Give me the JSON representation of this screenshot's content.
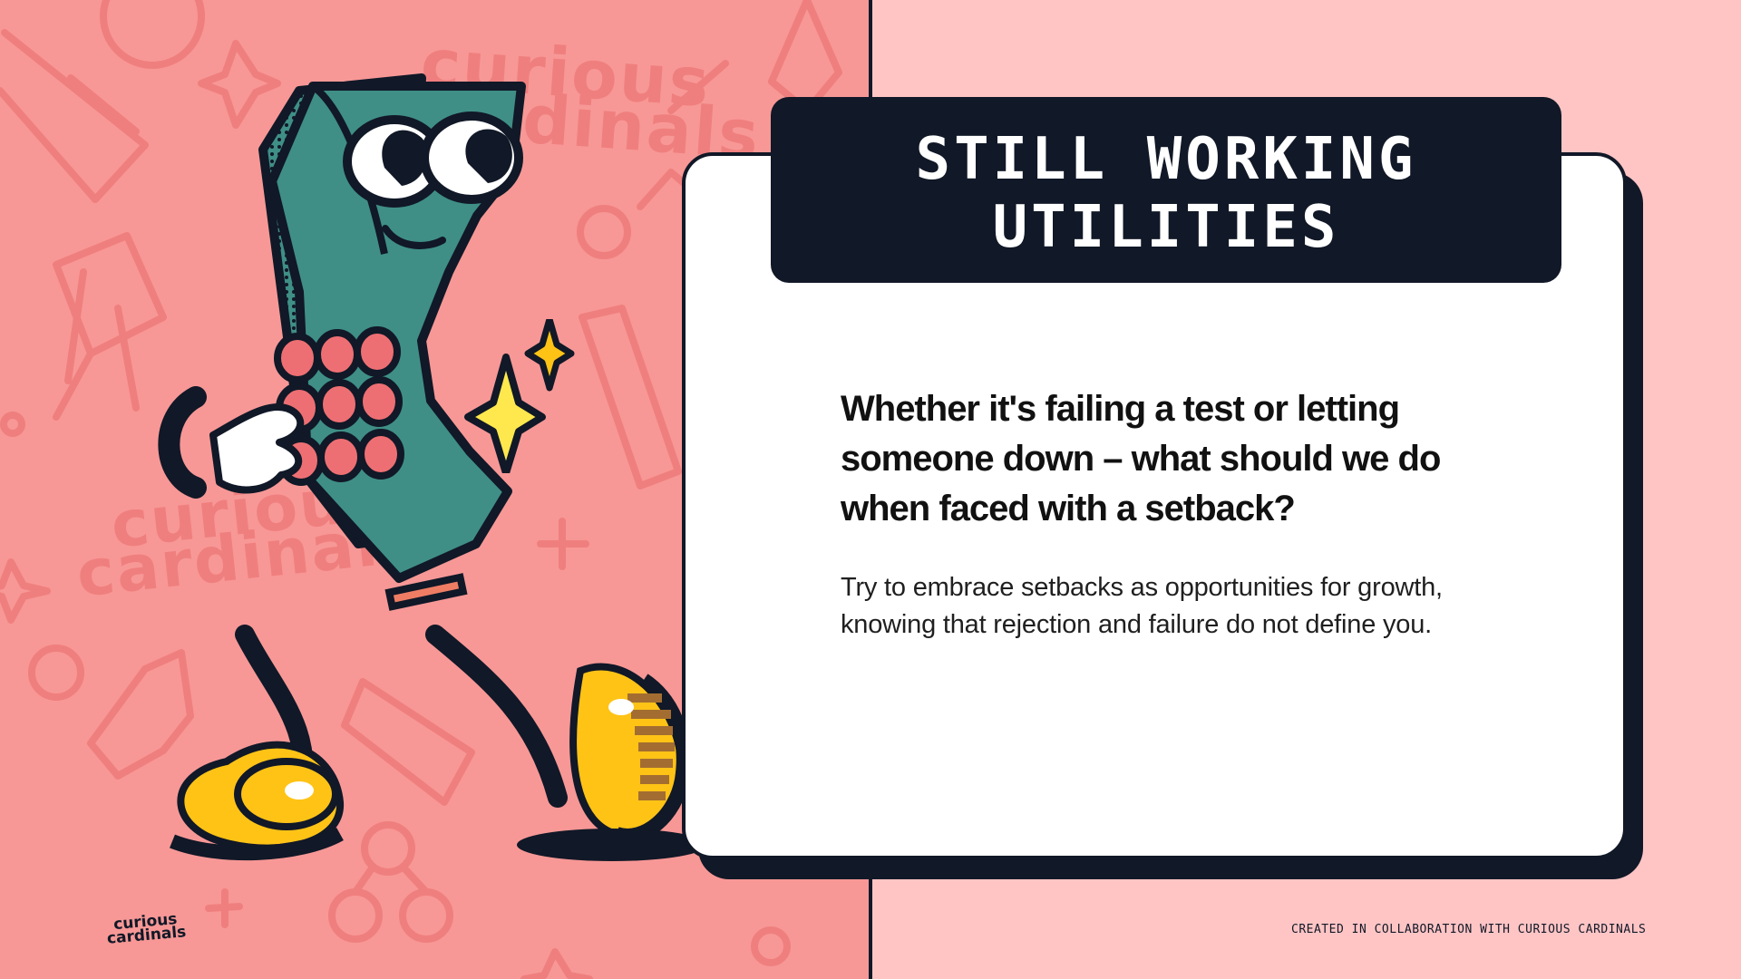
{
  "slide": {
    "title_lines": [
      "STILL WORKING",
      "UTILITIES"
    ],
    "heading": "Whether it's failing a test or letting someone down – what should we do when faced with a setback?",
    "body": "Try to embrace setbacks as opportunities for growth, knowing that rejection and failure do not define you.",
    "credit": "CREATED IN COLLABORATION WITH CURIOUS CARDINALS",
    "logo_text": "curious cardinals"
  },
  "colors": {
    "left_panel": "#f79896",
    "right_panel": "#ffc5c5",
    "dark": "#111827",
    "character_green": "#3f8f86",
    "button_red": "#ee6f73",
    "shoe_yellow": "#ffc316",
    "sparkle_yellow": "#ffe84d"
  },
  "icons": [
    "phone-character-illustration",
    "sparkle-icon"
  ]
}
